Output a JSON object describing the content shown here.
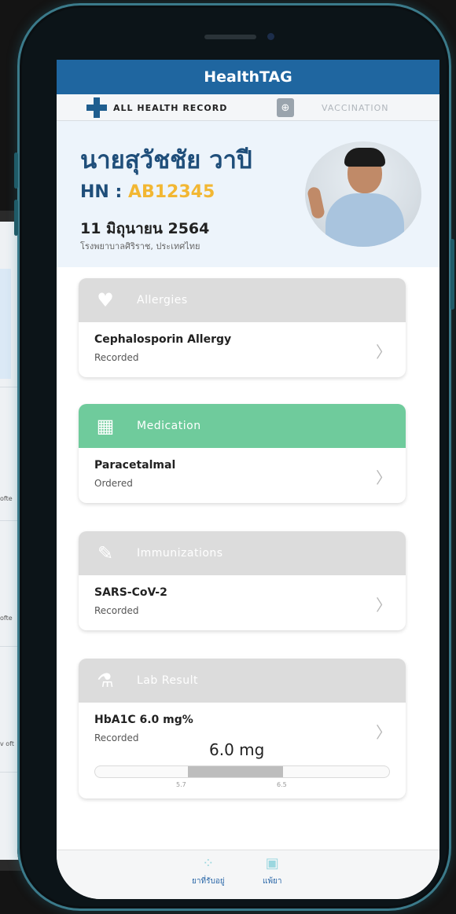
{
  "app": {
    "title": "HealthTAG"
  },
  "tabs": {
    "all_health_record": "ALL HEALTH RECORD",
    "vaccination": "VACCINATION"
  },
  "patient": {
    "name": "นายสุวัชชัย   วาปี",
    "hn_label": "HN : ",
    "hn_value": "AB12345",
    "date": "11 มิถุนายน 2564",
    "hospital": "โรงพยาบาลศิริราช, ประเทศไทย"
  },
  "sections": {
    "allergies": {
      "title": "Allergies",
      "item": "Cephalosporin Allergy",
      "status": "Recorded"
    },
    "medication": {
      "title": "Medication",
      "item": "Paracetalmal",
      "status": "Ordered"
    },
    "immunizations": {
      "title": "Immunizations",
      "item": "SARS-CoV-2",
      "status": "Recorded"
    },
    "lab_result": {
      "title": "Lab Result",
      "item": "HbA1C 6.0 mg%",
      "status": "Recorded",
      "value_display": "6.0 mg",
      "range_low": "5.7",
      "range_high": "6.5"
    }
  },
  "bottom_nav": {
    "current_meds": "ยาที่รับอยู่",
    "find_meds": "แพ้ยา"
  },
  "background_phone": {
    "snippets": [
      "ofte",
      "ofte",
      "v oft"
    ]
  },
  "colors": {
    "brand_blue": "#1f66a0",
    "hn_yellow": "#f2b733",
    "medication_green": "#6fcb9c",
    "inactive_gray": "#dcdcdc"
  }
}
